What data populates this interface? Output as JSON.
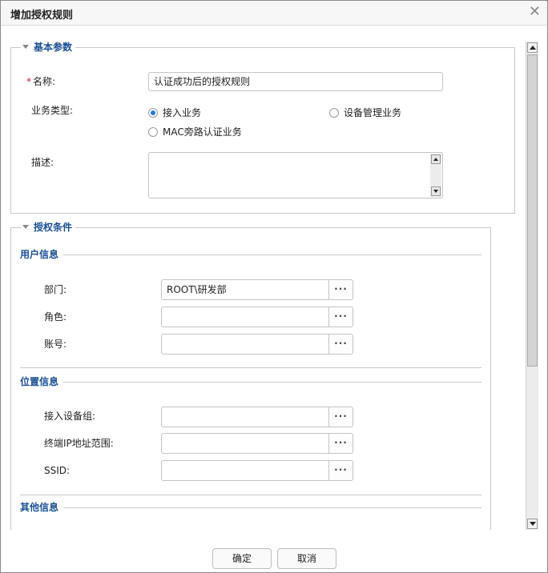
{
  "dialog": {
    "title": "增加授权规则"
  },
  "basic": {
    "legend": "基本参数",
    "name_label": "名称:",
    "name_value": "认证成功后的授权规则",
    "service_type_label": "业务类型:",
    "options": [
      "接入业务",
      "设备管理业务",
      "MAC旁路认证业务"
    ],
    "selected_option": "接入业务",
    "desc_label": "描述:",
    "desc_value": ""
  },
  "auth": {
    "legend": "授权条件",
    "user_info": {
      "title": "用户信息",
      "dept_label": "部门:",
      "dept_value": "ROOT\\研发部",
      "role_label": "角色:",
      "role_value": "",
      "account_label": "账号:",
      "account_value": ""
    },
    "location_info": {
      "title": "位置信息",
      "device_group_label": "接入设备组:",
      "device_group_value": "",
      "ip_range_label": "终端IP地址范围:",
      "ip_range_value": "",
      "ssid_label": "SSID:",
      "ssid_value": ""
    },
    "other_info": {
      "title": "其他信息"
    }
  },
  "picker_button_text": "···",
  "buttons": {
    "ok": "确定",
    "cancel": "取消"
  }
}
